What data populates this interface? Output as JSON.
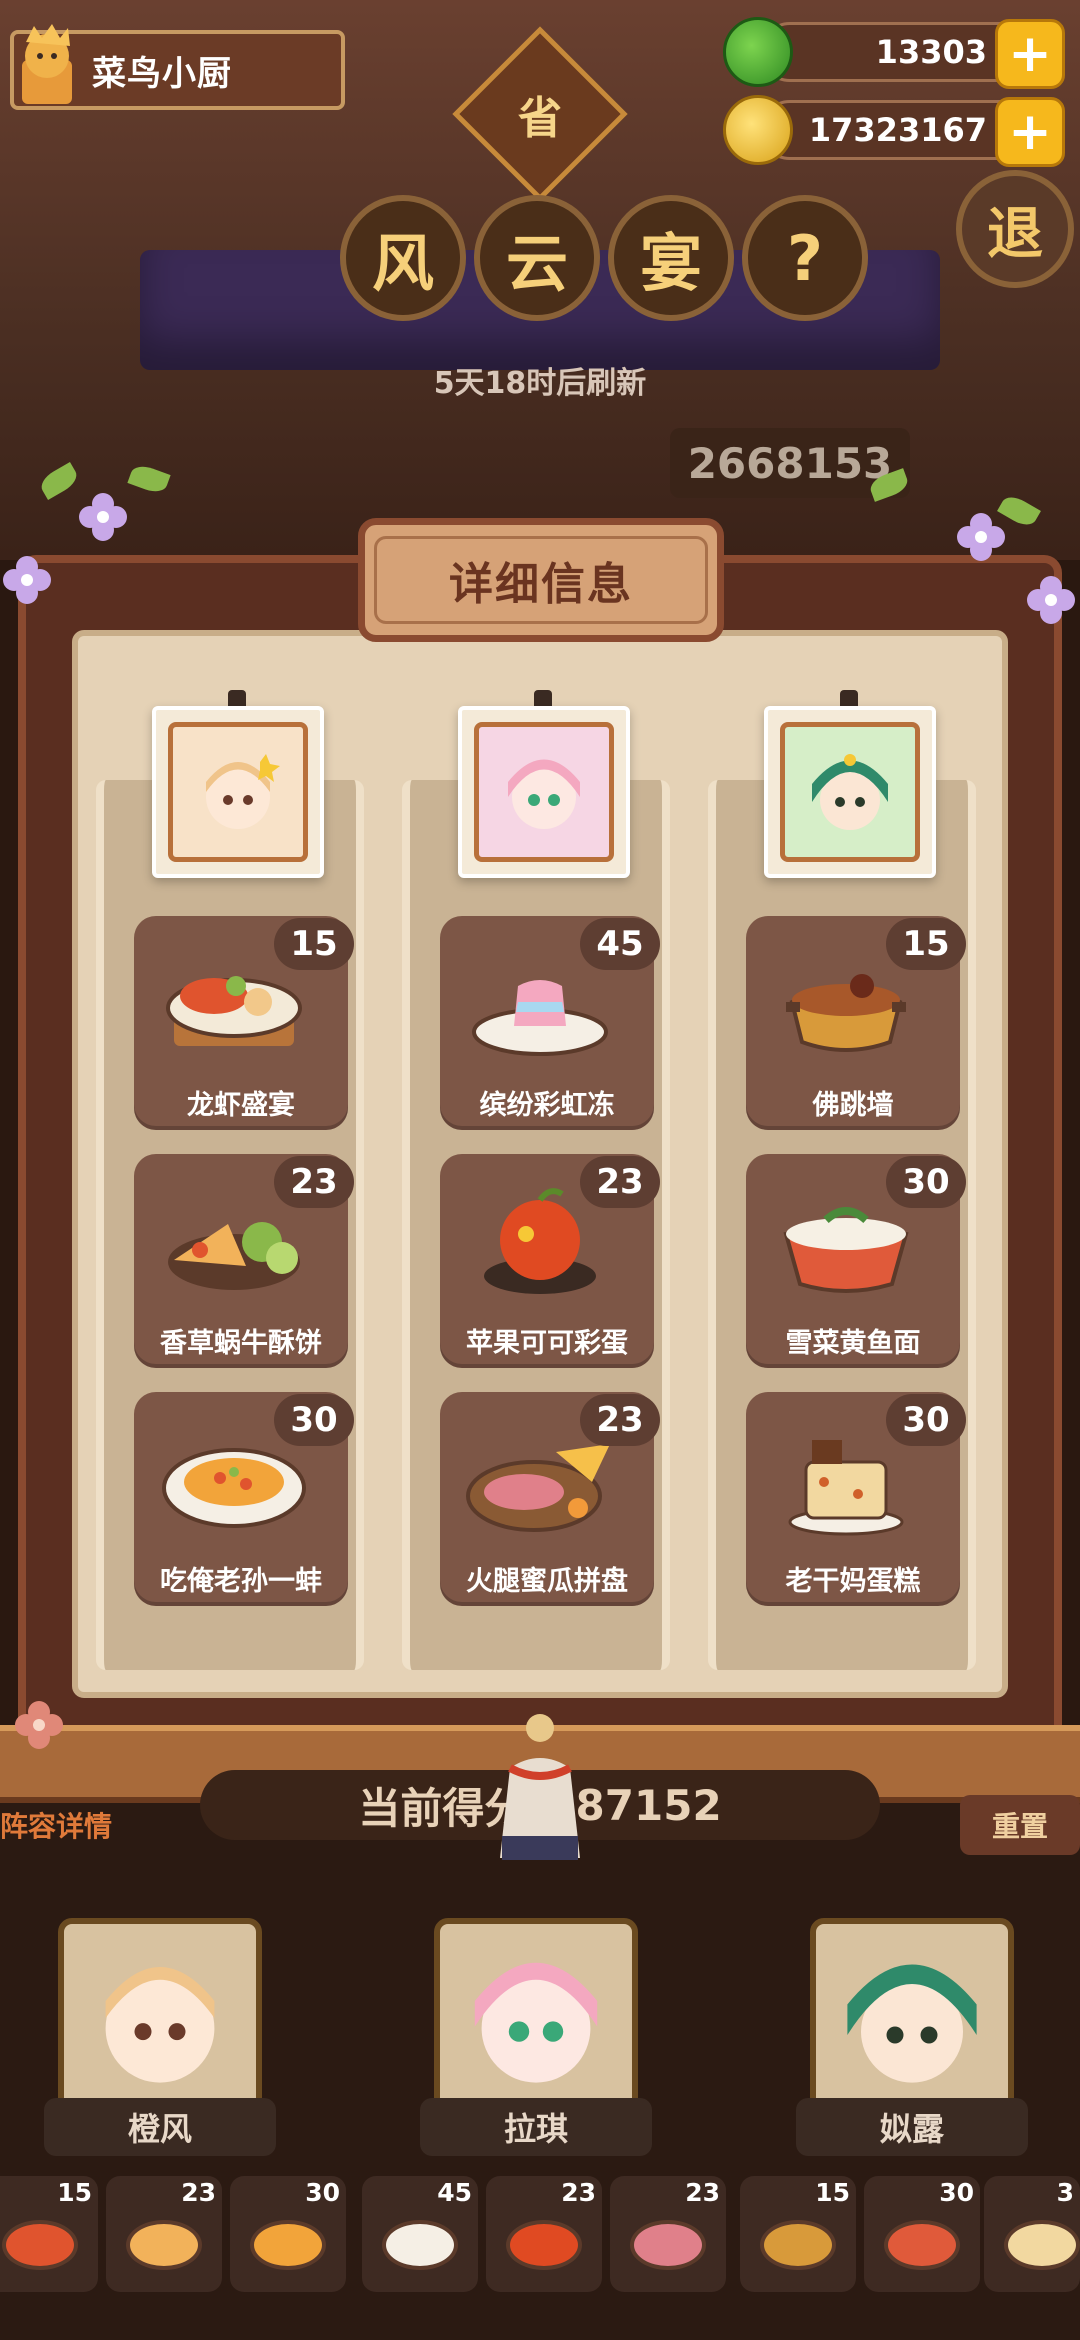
{
  "player": {
    "name": "菜鸟小厨"
  },
  "currencies": {
    "jade": "13303",
    "coins": "17323167",
    "plus": "+"
  },
  "header": {
    "province": "省",
    "title_chars": [
      "风",
      "云",
      "宴",
      "?"
    ],
    "exit_label": "退",
    "refresh_text": "5天18时后刷新",
    "background_score": "2668153"
  },
  "panel": {
    "title": "详细信息",
    "columns": [
      {
        "chef": "橙风",
        "dishes": [
          {
            "name": "龙虾盛宴",
            "count": "15"
          },
          {
            "name": "香草蜗牛酥饼",
            "count": "23"
          },
          {
            "name": "吃俺老孙一蚌",
            "count": "30"
          }
        ]
      },
      {
        "chef": "拉琪",
        "dishes": [
          {
            "name": "缤纷彩虹冻",
            "count": "45"
          },
          {
            "name": "苹果可可彩蛋",
            "count": "23"
          },
          {
            "name": "火腿蜜瓜拼盘",
            "count": "23"
          }
        ]
      },
      {
        "chef": "姒露",
        "dishes": [
          {
            "name": "佛跳墙",
            "count": "15"
          },
          {
            "name": "雪菜黄鱼面",
            "count": "30"
          },
          {
            "name": "老干妈蛋糕",
            "count": "30"
          }
        ]
      }
    ]
  },
  "bottom": {
    "score_label": "当前得分",
    "score_value": "587152",
    "lineup_label": "阵容详情",
    "reset_label": "重置",
    "chefs": [
      "橙风",
      "拉琪",
      "姒露"
    ],
    "mini_dishes": [
      "15",
      "23",
      "30",
      "45",
      "23",
      "23",
      "15",
      "30",
      "3"
    ]
  },
  "colors": {
    "panel_wood": "#8a4a30",
    "panel_paper": "#e5d2b6",
    "dish_card": "#7d5646",
    "accent_gold": "#f6b81c"
  }
}
